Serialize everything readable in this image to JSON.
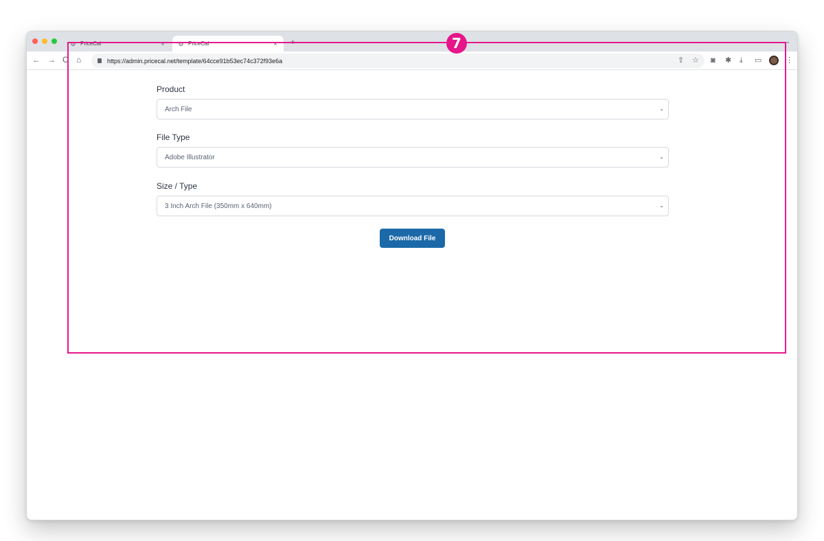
{
  "browser": {
    "tabs": [
      {
        "title": "PriceCal",
        "close": "×"
      },
      {
        "title": "PriceCal",
        "close": "×"
      }
    ],
    "new_tab": "+",
    "tab_menu": "⌄",
    "nav": {
      "back": "←",
      "forward": "→",
      "reload": "C",
      "home": "⌂"
    },
    "url": "https://admin.pricecal.net/template/64cce91b53ec74c372f93e6a",
    "toolbar_icons": [
      "share-icon",
      "bookmark-star-icon",
      "camera-icon",
      "extensions-puzzle-icon",
      "download-icon",
      "side-panel-icon",
      "profile-avatar",
      "more-menu-icon"
    ]
  },
  "form": {
    "product": {
      "label": "Product",
      "value": "Arch File"
    },
    "file_type": {
      "label": "File Type",
      "value": "Adobe Illustrator"
    },
    "size_type": {
      "label": "Size / Type",
      "value": "3 Inch Arch File (350mm x 640mm)"
    },
    "download_label": "Download File"
  },
  "annotation": {
    "step": "7",
    "color": "#e6168a"
  },
  "colors": {
    "primary_button": "#1b69a8"
  }
}
